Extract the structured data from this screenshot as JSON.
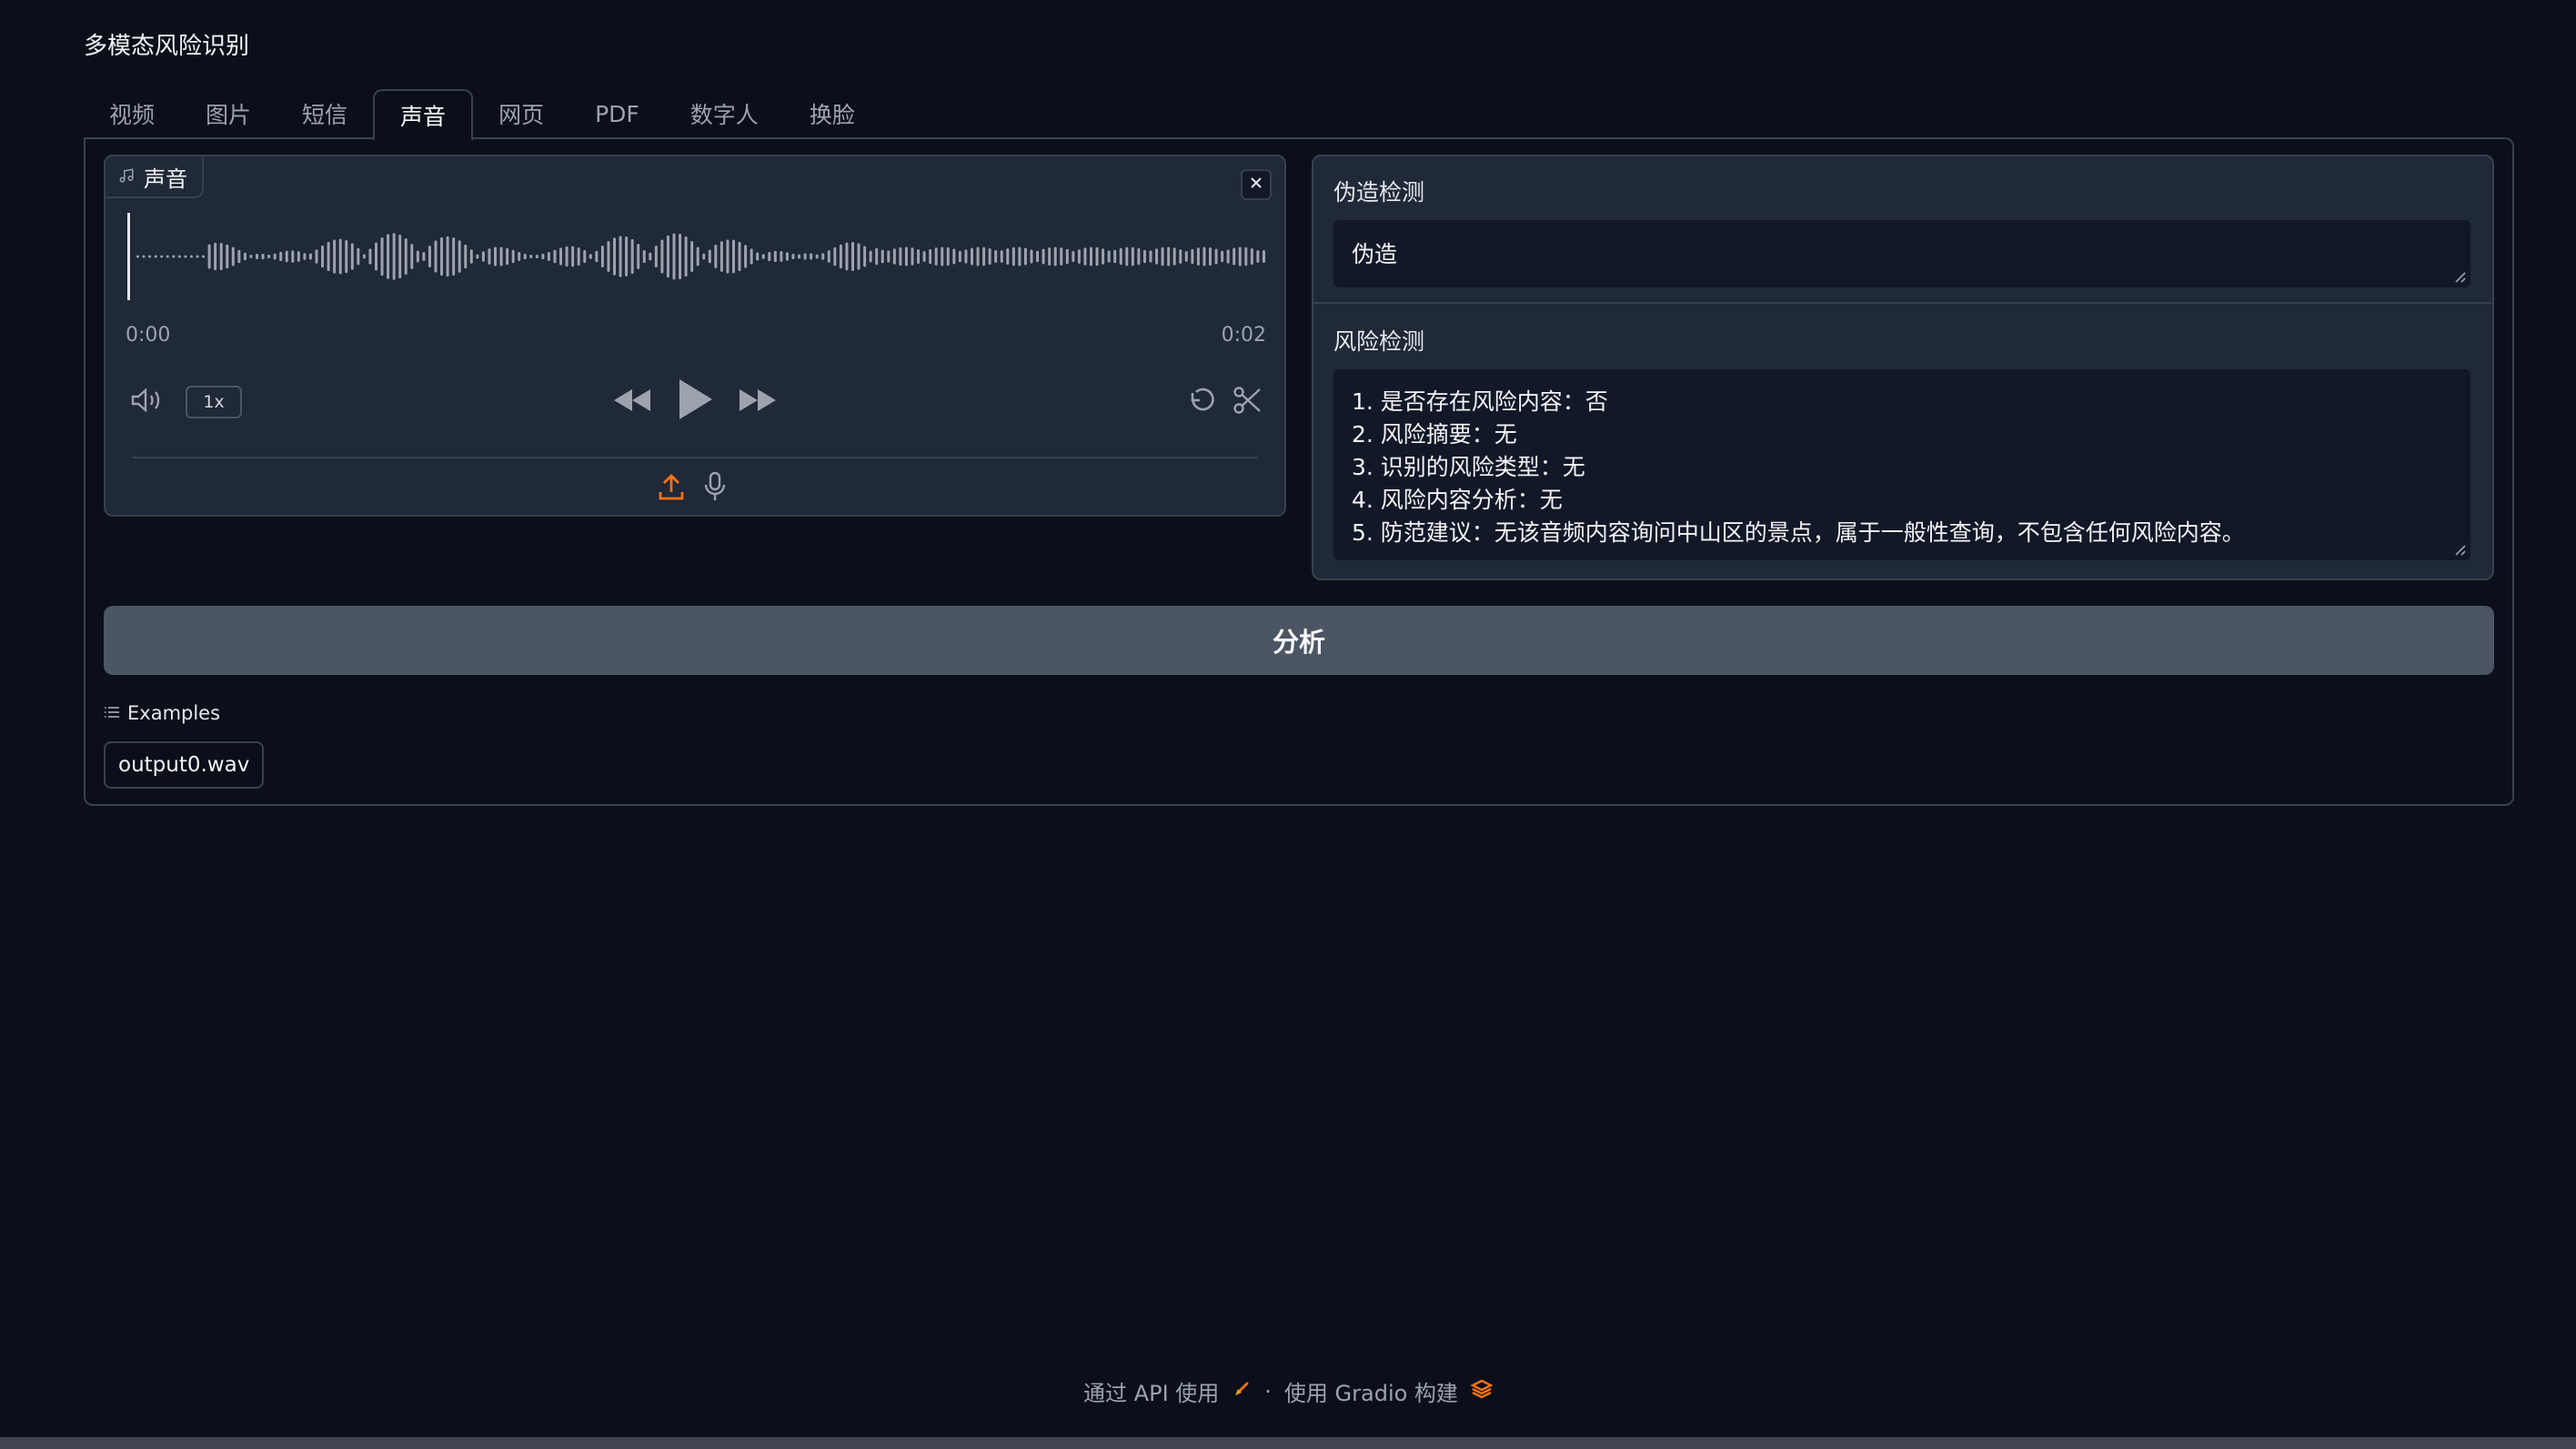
{
  "app": {
    "title": "多模态风险识别"
  },
  "tabs": [
    {
      "label": "视频"
    },
    {
      "label": "图片"
    },
    {
      "label": "短信"
    },
    {
      "label": "声音",
      "active": true
    },
    {
      "label": "网页"
    },
    {
      "label": "PDF"
    },
    {
      "label": "数字人"
    },
    {
      "label": "换脸"
    }
  ],
  "audio": {
    "label": "声音",
    "label_icon": "music-note-icon",
    "time_current": "0:00",
    "time_total": "0:02",
    "playback_rate": "1x",
    "icons": [
      "volume-icon",
      "rewind-icon",
      "play-icon",
      "fast-forward-icon",
      "undo-icon",
      "scissors-icon",
      "upload-icon",
      "microphone-icon",
      "close-icon"
    ]
  },
  "forgery": {
    "label": "伪造检测",
    "value": "伪造"
  },
  "risk": {
    "label": "风险检测",
    "lines": [
      "1. 是否存在风险内容：否",
      "2. 风险摘要：无",
      "3. 识别的风险类型：无",
      "4. 风险内容分析：无",
      "5. 防范建议：无该音频内容询问中山区的景点，属于一般性查询，不包含任何风险内容。"
    ]
  },
  "analyze_button": {
    "label": "分析"
  },
  "examples": {
    "label": "Examples",
    "items": [
      "output0.wav"
    ]
  },
  "footer": {
    "api_link": "通过 API 使用",
    "separator": "·",
    "built_with": "使用 Gradio 构建"
  },
  "colors": {
    "background": "#0b0f19",
    "panel": "#1f2937",
    "border": "#374151",
    "button": "#4b5563",
    "accent_orange": "#f97316"
  }
}
